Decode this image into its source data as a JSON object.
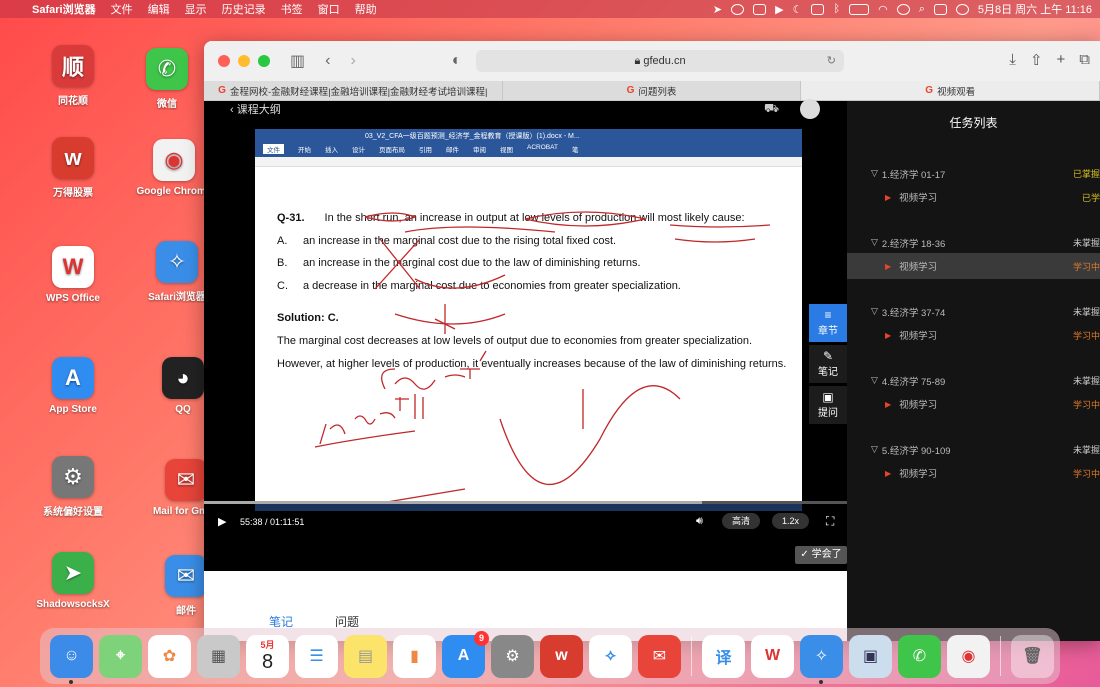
{
  "menubar": {
    "items": [
      "Safari浏览器",
      "文件",
      "编辑",
      "显示",
      "历史记录",
      "书签",
      "窗口",
      "帮助"
    ],
    "clock": "5月8日 周六 上午 11:16"
  },
  "desktop": {
    "icons": [
      {
        "label": "同花顺",
        "glyph": "顺",
        "color": "#d93a3a"
      },
      {
        "label": "微信",
        "glyph": "✆",
        "color": "#3ec54a"
      },
      {
        "label": "万得股票",
        "glyph": "w",
        "color": "#d73c2e"
      },
      {
        "label": "Google Chrome",
        "glyph": "◉",
        "color": "#f2f2f2"
      },
      {
        "label": "WPS Office",
        "glyph": "W",
        "color": "#fff"
      },
      {
        "label": "Safari浏览器",
        "glyph": "✧",
        "color": "#3a8ee8"
      },
      {
        "label": "App Store",
        "glyph": "A",
        "color": "#2f8cf0"
      },
      {
        "label": "QQ",
        "glyph": "◕",
        "color": "#222"
      },
      {
        "label": "系统偏好设置",
        "glyph": "⚙",
        "color": "#777"
      },
      {
        "label": "Mail for Gmail",
        "glyph": "✉",
        "color": "#e8443a"
      },
      {
        "label": "ShadowsocksX",
        "glyph": "➤",
        "color": "#3bb04a"
      },
      {
        "label": "邮件",
        "glyph": "✉",
        "color": "#3a8ee8"
      }
    ]
  },
  "browser": {
    "url": "gfedu.cn",
    "tabs": [
      {
        "label": "金程网校-金融财经课程|金融培训课程|金融财经考试培训课程|"
      },
      {
        "label": "问题列表"
      },
      {
        "label": "视频观看"
      }
    ]
  },
  "player": {
    "back_label": "课程大纲",
    "doc_title": "03_V2_CFA一级百题预测_经济学_金程教育（授课版）(1).docx - M...",
    "ribbon_tabs": [
      "文件",
      "开始",
      "插入",
      "设计",
      "页面布局",
      "引用",
      "邮件",
      "审阅",
      "视图",
      "ACROBAT",
      "笔"
    ],
    "question": {
      "number": "Q-31.",
      "text": "In the short run, an increase in output at low levels of production will most likely cause:",
      "options": [
        {
          "key": "A.",
          "text": "an increase in the marginal cost due to the rising total fixed cost."
        },
        {
          "key": "B.",
          "text": "an increase in the marginal cost due to the law of diminishing returns."
        },
        {
          "key": "C.",
          "text": "a decrease in the marginal cost due to economies from greater specialization."
        }
      ],
      "solution_label": "Solution: C.",
      "solution_text": "The marginal cost decreases at low levels of output due to economies from greater specialization. However, at higher levels of production, it eventually increases because of the law of diminishing returns."
    },
    "time": "55:38 / 01:11:51",
    "progress": 0.774,
    "quality": "高清",
    "speed": "1.2x",
    "learned_label": "学会了",
    "side_buttons": [
      "章节",
      "笔记",
      "提问"
    ],
    "below_tabs": [
      "笔记",
      "问题"
    ]
  },
  "tasks": {
    "title": "任务列表",
    "groups": [
      {
        "name": "1.经济学 01-17",
        "status": "已掌握",
        "sub": "视频学习",
        "sub_status": "已学"
      },
      {
        "name": "2.经济学 18-36",
        "status": "未掌握",
        "sub": "视频学习",
        "sub_status": "学习中"
      },
      {
        "name": "3.经济学 37-74",
        "status": "未掌握",
        "sub": "视频学习",
        "sub_status": "学习中"
      },
      {
        "name": "4.经济学 75-89",
        "status": "未掌握",
        "sub": "视频学习",
        "sub_status": "学习中"
      },
      {
        "name": "5.经济学 90-109",
        "status": "未掌握",
        "sub": "视频学习",
        "sub_status": "学习中"
      }
    ]
  },
  "colors": {
    "accent": "#2a7be4",
    "brand": "#e8432d",
    "mastered": "#d4c020",
    "learning": "#e07a2a"
  },
  "dock": {
    "calendar_month": "5月",
    "calendar_day": "8",
    "appstore_badge": "9"
  }
}
